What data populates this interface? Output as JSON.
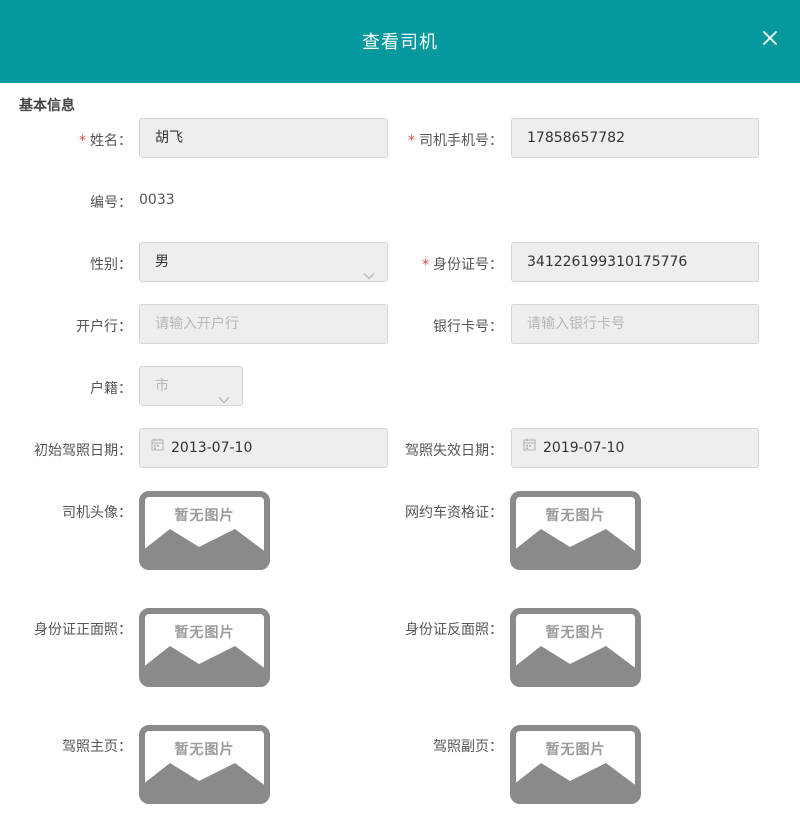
{
  "header": {
    "title": "查看司机"
  },
  "section": {
    "title": "基本信息"
  },
  "fields": {
    "name": {
      "label": "姓名：",
      "value": "胡飞"
    },
    "phone": {
      "label": "司机手机号：",
      "value": "17858657782"
    },
    "number": {
      "label": "编号：",
      "value": "0033"
    },
    "gender": {
      "label": "性别：",
      "value": "男"
    },
    "id_card": {
      "label": "身份证号：",
      "value": "341226199310175776"
    },
    "bank": {
      "label": "开户行：",
      "placeholder": "请输入开户行"
    },
    "bank_card": {
      "label": "银行卡号：",
      "placeholder": "请输入银行卡号"
    },
    "household": {
      "label": "户籍：",
      "placeholder": "市"
    },
    "license_start": {
      "label": "初始驾照日期：",
      "value": "2013-07-10"
    },
    "license_expiry": {
      "label": "驾照失效日期：",
      "value": "2019-07-10"
    }
  },
  "images": {
    "placeholder_text": "暂无图片",
    "avatar": {
      "label": "司机头像："
    },
    "taxi_cert": {
      "label": "网约车资格证："
    },
    "id_front": {
      "label": "身份证正面照："
    },
    "id_back": {
      "label": "身份证反面照："
    },
    "license_main": {
      "label": "驾照主页："
    },
    "license_sub": {
      "label": "驾照副页："
    }
  },
  "required_mark": "*",
  "colors": {
    "header": "#05999e",
    "required": "#e04848",
    "input_bg": "#eeeeee"
  }
}
